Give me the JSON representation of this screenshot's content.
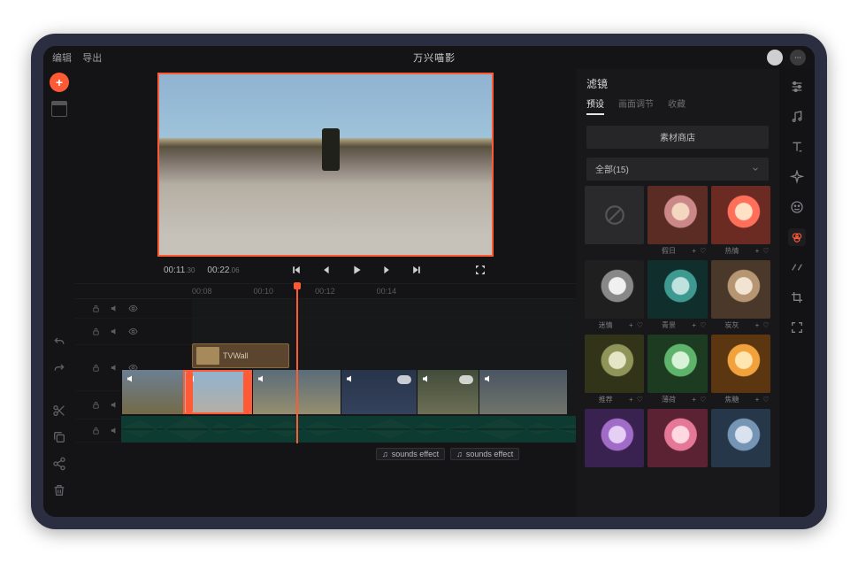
{
  "topbar": {
    "edit": "编辑",
    "export": "导出",
    "title": "万兴喵影"
  },
  "transport": {
    "current": "00:11",
    "current_frames": ".30",
    "total": "00:22",
    "total_frames": ".06"
  },
  "ruler": [
    "00:08",
    "00:10",
    "00:12",
    "00:14"
  ],
  "overlay_clip": {
    "name": "TVWall"
  },
  "sound_clips": [
    "sounds effect",
    "sounds effect"
  ],
  "rightpanel": {
    "title": "滤镜",
    "tabs": {
      "preset": "预设",
      "adjust": "画面调节",
      "fav": "收藏"
    },
    "store": "素材商店",
    "dropdown": "全部(15)",
    "filters": [
      {
        "name": ""
      },
      {
        "name": "假日"
      },
      {
        "name": "热情"
      },
      {
        "name": "迷情"
      },
      {
        "name": "青景"
      },
      {
        "name": "炭灰"
      },
      {
        "name": "推荐"
      },
      {
        "name": "薄荷"
      },
      {
        "name": "焦糖"
      },
      {
        "name": ""
      },
      {
        "name": ""
      },
      {
        "name": ""
      }
    ]
  }
}
